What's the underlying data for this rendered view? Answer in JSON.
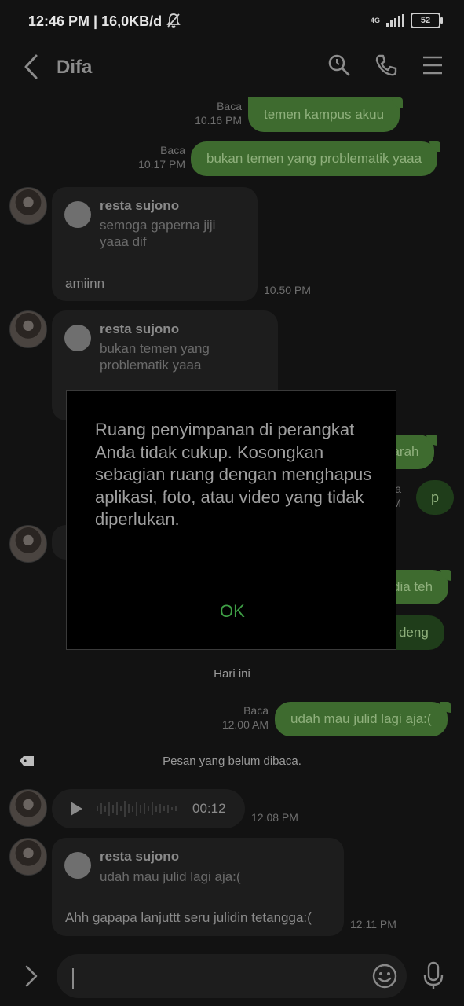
{
  "status_bar": {
    "time": "12:46 PM",
    "speed": "16,0KB/d",
    "network": "4G",
    "battery": "52"
  },
  "header": {
    "title": "Difa"
  },
  "messages": {
    "m1": {
      "status": "Baca",
      "time": "10.16 PM",
      "text": "temen kampus akuu"
    },
    "m2": {
      "status": "Baca",
      "time": "10.17 PM",
      "text": "bukan temen yang problematik yaaa"
    },
    "m3": {
      "quote_name": "resta sujono",
      "quote_text": "semoga gaperna jiji yaaa dif",
      "text": "amiinn",
      "time": "10.50 PM"
    },
    "m4": {
      "quote_name": "resta sujono",
      "quote_text": "bukan temen yang problematik yaaa"
    },
    "m5_fragment": "oarah",
    "m6": {
      "status_fragment": "ca",
      "time_fragment": "PM",
      "text": "p"
    },
    "m7_fragment": "dia teh",
    "m8_fragment": "di deng",
    "date_divider": "Hari ini",
    "m9": {
      "status": "Baca",
      "time": "12.00 AM",
      "text": "udah mau julid lagi aja:("
    },
    "unread_divider": "Pesan yang belum dibaca.",
    "m10": {
      "duration": "00:12",
      "time": "12.08 PM"
    },
    "m11": {
      "quote_name": "resta sujono",
      "quote_text": "udah mau julid lagi aja:(",
      "text": "Ahh gapapa lanjuttt seru julidin tetangga:(",
      "time": "12.11 PM"
    }
  },
  "dialog": {
    "message": "Ruang penyimpanan di perangkat Anda tidak cukup. Kosongkan sebagian ruang dengan menghapus aplikasi, foto, atau video yang tidak diperlukan.",
    "ok_label": "OK"
  },
  "colors": {
    "background": "#121212",
    "sent_bubble": "#3e6b2f",
    "received_bubble": "#1d1d1d",
    "dialog_ok": "#3fa046"
  },
  "icons": [
    "back-icon",
    "search-icon",
    "phone-icon",
    "menu-icon",
    "play-icon",
    "emoji-icon",
    "mic-icon",
    "expand-icon",
    "tag-icon",
    "mute-bell-icon"
  ]
}
